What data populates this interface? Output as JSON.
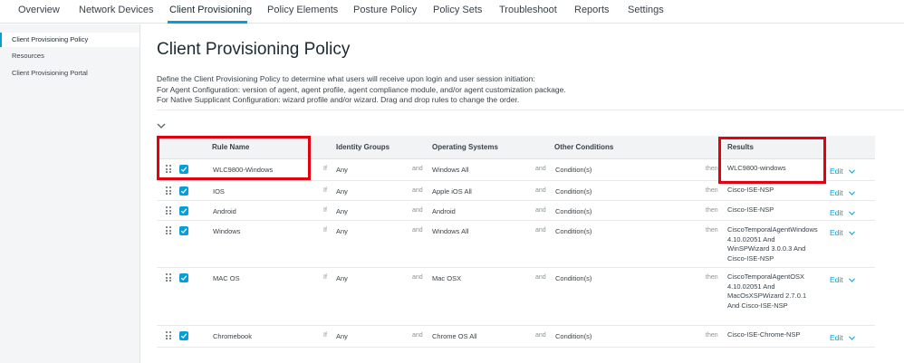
{
  "nav": {
    "tabs": [
      {
        "label": "Overview"
      },
      {
        "label": "Network Devices"
      },
      {
        "label": "Client Provisioning"
      },
      {
        "label": "Policy Elements"
      },
      {
        "label": "Posture Policy"
      },
      {
        "label": "Policy Sets"
      },
      {
        "label": "Troubleshoot"
      },
      {
        "label": "Reports"
      },
      {
        "label": "Settings"
      }
    ],
    "active_tab": "Client Provisioning"
  },
  "sidebar": {
    "items": [
      {
        "label": "Client Provisioning Policy"
      },
      {
        "label": "Resources"
      },
      {
        "label": "Client Provisioning Portal"
      }
    ]
  },
  "page": {
    "title": "Client Provisioning Policy",
    "description": [
      "Define the Client Provisioning Policy to determine what users will receive upon login and user session initiation:",
      "For Agent Configuration: version of agent, agent profile, agent compliance module, and/or agent customization package.",
      "For Native Supplicant Configuration: wizard profile and/or wizard. Drag and drop rules to change the order."
    ]
  },
  "table": {
    "headers": {
      "rule_name": "Rule Name",
      "identity_groups": "Identity Groups",
      "operating_systems": "Operating Systems",
      "other_conditions": "Other Conditions",
      "results": "Results"
    },
    "keywords": {
      "if": "If",
      "and": "and",
      "then": "then"
    },
    "edit_label": "Edit",
    "rows": [
      {
        "name": "WLC9800-Windows",
        "identity": "Any",
        "os": "Windows All",
        "conditions": "Condition(s)",
        "result": "WLC9800-windows",
        "enabled": true
      },
      {
        "name": "IOS",
        "identity": "Any",
        "os": "Apple iOS All",
        "conditions": "Condition(s)",
        "result": "Cisco-ISE-NSP",
        "enabled": true
      },
      {
        "name": "Android",
        "identity": "Any",
        "os": "Android",
        "conditions": "Condition(s)",
        "result": "Cisco-ISE-NSP",
        "enabled": true
      },
      {
        "name": "Windows",
        "identity": "Any",
        "os": "Windows All",
        "conditions": "Condition(s)",
        "result": "CiscoTemporalAgentWindows 4.10.02051 And WinSPWizard 3.0.0.3 And Cisco-ISE-NSP",
        "enabled": true
      },
      {
        "name": "MAC OS",
        "identity": "Any",
        "os": "Mac OSX",
        "conditions": "Condition(s)",
        "result": "CiscoTemporalAgentOSX 4.10.02051 And MacOsXSPWizard 2.7.0.1 And Cisco-ISE-NSP",
        "enabled": true
      },
      {
        "name": "Chromebook",
        "identity": "Any",
        "os": "Chrome OS All",
        "conditions": "Condition(s)",
        "result": "Cisco-ISE-Chrome-NSP",
        "enabled": true
      }
    ]
  },
  "colors": {
    "accent": "#049fd9",
    "highlight": "#e3000f"
  }
}
